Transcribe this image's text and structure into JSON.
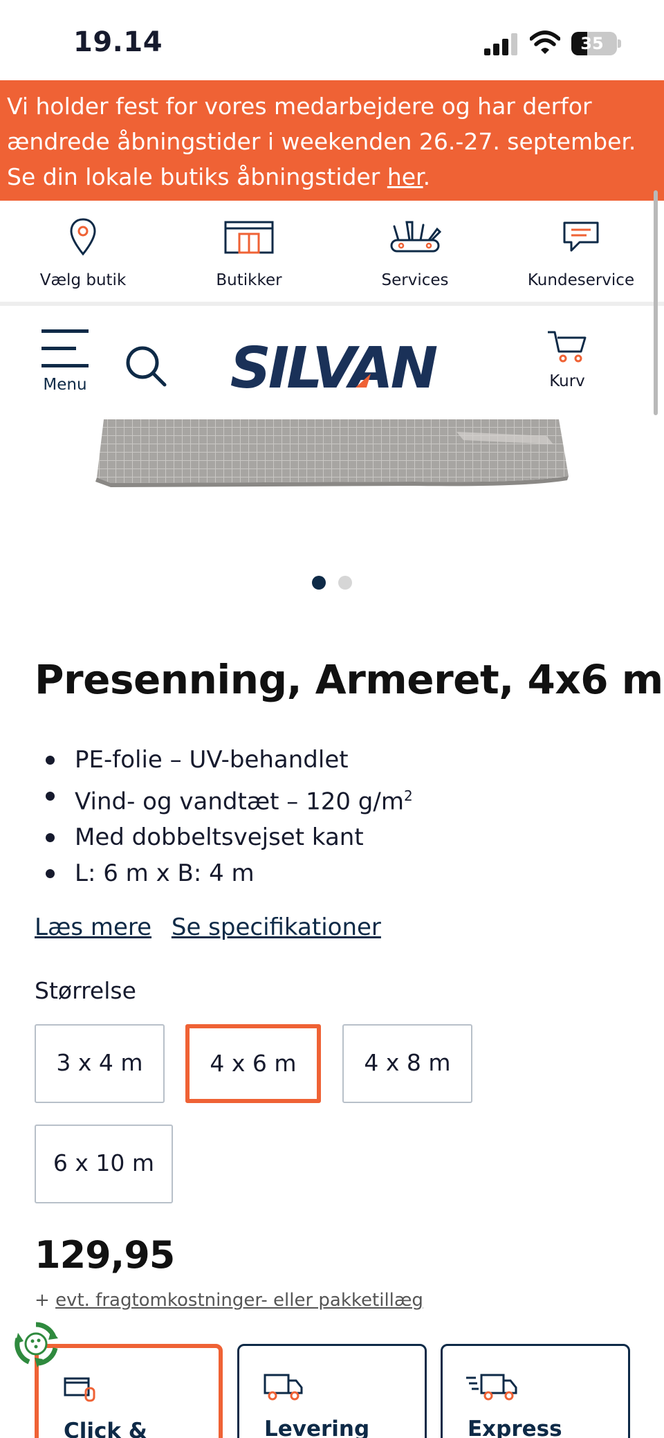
{
  "status_bar": {
    "time": "19.14",
    "battery": "35"
  },
  "banner": {
    "text": "Vi holder fest for vores medarbejdere og har derfor ændrede åbningstider i weekenden 26.-27. september. Se din lokale butiks åbningstider ",
    "link": "her",
    "end": "."
  },
  "quick_links": [
    {
      "label": "Vælg butik",
      "icon": "location-pin-icon"
    },
    {
      "label": "Butikker",
      "icon": "store-icon"
    },
    {
      "label": "Services",
      "icon": "tools-icon"
    },
    {
      "label": "Kundeservice",
      "icon": "chat-icon"
    }
  ],
  "header": {
    "menu_label": "Menu",
    "logo_text": "SILVAN",
    "cart_label": "Kurv"
  },
  "gallery": {
    "count": 2,
    "active_index": 0
  },
  "product": {
    "title": "Presenning, Armeret, 4x6 m",
    "features": [
      "PE-folie – UV-behandlet",
      "Vind- og vandtæt – 120 g/m",
      "Med dobbeltsvejset kant",
      "L: 6 m x B: 4 m"
    ],
    "feature_superscript": "2",
    "read_more": "Læs mere",
    "see_specs": "Se specifikationer",
    "size_label": "Størrelse",
    "sizes": [
      "3 x 4 m",
      "4 x 6 m",
      "4 x 8 m",
      "6 x 10 m"
    ],
    "selected_size": "4 x 6 m",
    "price": "129,95",
    "shipping_prefix": "+ ",
    "shipping_link": "evt. fragtomkostninger- eller pakketillæg"
  },
  "delivery_options": [
    {
      "label": "Click &",
      "selected": true
    },
    {
      "label": "Levering",
      "selected": false
    },
    {
      "label": "Express",
      "selected": false
    }
  ],
  "colors": {
    "accent": "#ef6235",
    "navy": "#0e2a47",
    "text": "#161a2d"
  }
}
